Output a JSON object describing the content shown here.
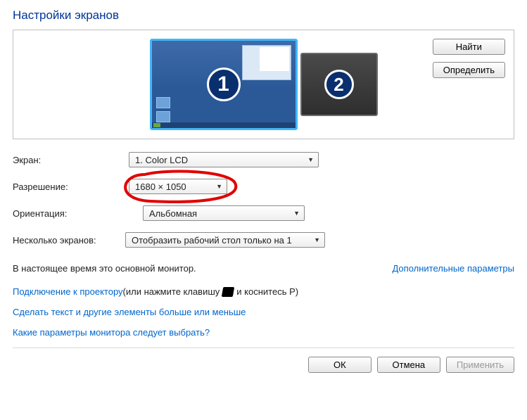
{
  "title": "Настройки экранов",
  "buttons": {
    "find": "Найти",
    "identify": "Определить",
    "ok": "ОК",
    "cancel": "Отмена",
    "apply": "Применить"
  },
  "monitors": {
    "primary_number": "1",
    "secondary_number": "2"
  },
  "labels": {
    "display": "Экран:",
    "resolution": "Разрешение:",
    "orientation": "Ориентация:",
    "multiple": "Несколько экранов:"
  },
  "values": {
    "display": "1. Color LCD",
    "resolution": "1680 × 1050",
    "orientation": "Альбомная",
    "multiple": "Отобразить рабочий стол только на 1"
  },
  "info": {
    "primary_text": "В настоящее время это основной монитор.",
    "advanced_link": "Дополнительные параметры"
  },
  "links": {
    "projector_prefix": "Подключение к проектору",
    "projector_suffix_a": " (или нажмите клавишу ",
    "projector_suffix_b": " и коснитесь P)",
    "dpi": "Сделать текст и другие элементы больше или меньше",
    "help": "Какие параметры монитора следует выбрать?"
  }
}
